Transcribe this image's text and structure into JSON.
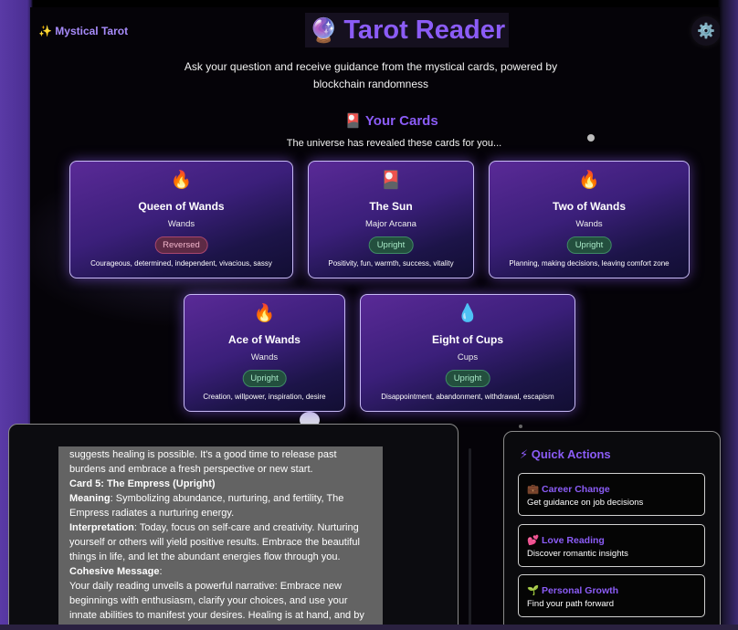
{
  "app": {
    "brand": "✨ Mystical Tarot",
    "title_icon": "🔮",
    "title": "Tarot Reader",
    "settings_icon": "⚙️",
    "subtitle": "Ask your question and receive guidance from the mystical cards, powered by blockchain randomness"
  },
  "cards_section": {
    "title": "🎴 Your Cards",
    "subtitle": "The universe has revealed these cards for you..."
  },
  "cards": [
    {
      "icon": "🔥",
      "name": "Queen of Wands",
      "suit": "Wands",
      "orientation": "Reversed",
      "keywords": "Courageous, determined, independent, vivacious, sassy"
    },
    {
      "icon": "🎴",
      "name": "The Sun",
      "suit": "Major Arcana",
      "orientation": "Upright",
      "keywords": "Positivity, fun, warmth, success, vitality"
    },
    {
      "icon": "🔥",
      "name": "Two of Wands",
      "suit": "Wands",
      "orientation": "Upright",
      "keywords": "Planning, making decisions, leaving comfort zone"
    },
    {
      "icon": "🔥",
      "name": "Ace of Wands",
      "suit": "Wands",
      "orientation": "Upright",
      "keywords": "Creation, willpower, inspiration, desire"
    },
    {
      "icon": "💧",
      "name": "Eight of Cups",
      "suit": "Cups",
      "orientation": "Upright",
      "keywords": "Disappointment, abandonment, withdrawal, escapism"
    }
  ],
  "reading": {
    "intro": "suggests healing is possible. It's a good time to release past burdens and embrace a fresh perspective or new start.",
    "card5_heading": "Card 5: The Empress (Upright)",
    "meaning_label": "Meaning",
    "meaning_text": ": Symbolizing abundance, nurturing, and fertility, The Empress radiates a nurturing energy.",
    "interpretation_label": "Interpretation",
    "interpretation_text": ": Today, focus on self-care and creativity. Nurturing yourself or others will yield positive results. Embrace the beautiful things in life, and let the abundant energies flow through you.",
    "cohesive_label": "Cohesive Message",
    "cohesive_colon": ":",
    "cohesive_text": "Your daily reading unveils a powerful narrative: Embrace new beginnings with enthusiasm, clarify your choices, and use your innate abilities to manifest your desires. Healing is at hand, and by nurturing yourself, you will find abundance in your"
  },
  "quick_actions": {
    "title": "⚡ Quick Actions",
    "items": [
      {
        "icon": "💼",
        "title": "Career Change",
        "subtitle": "Get guidance on job decisions"
      },
      {
        "icon": "💕",
        "title": "Love Reading",
        "subtitle": "Discover romantic insights"
      },
      {
        "icon": "🌱",
        "title": "Personal Growth",
        "subtitle": "Find your path forward"
      }
    ]
  },
  "colors": {
    "accent": "#8b5cf6",
    "brand": "#a78bfa",
    "upright": "#3f8a66",
    "reversed": "#a8466e"
  }
}
